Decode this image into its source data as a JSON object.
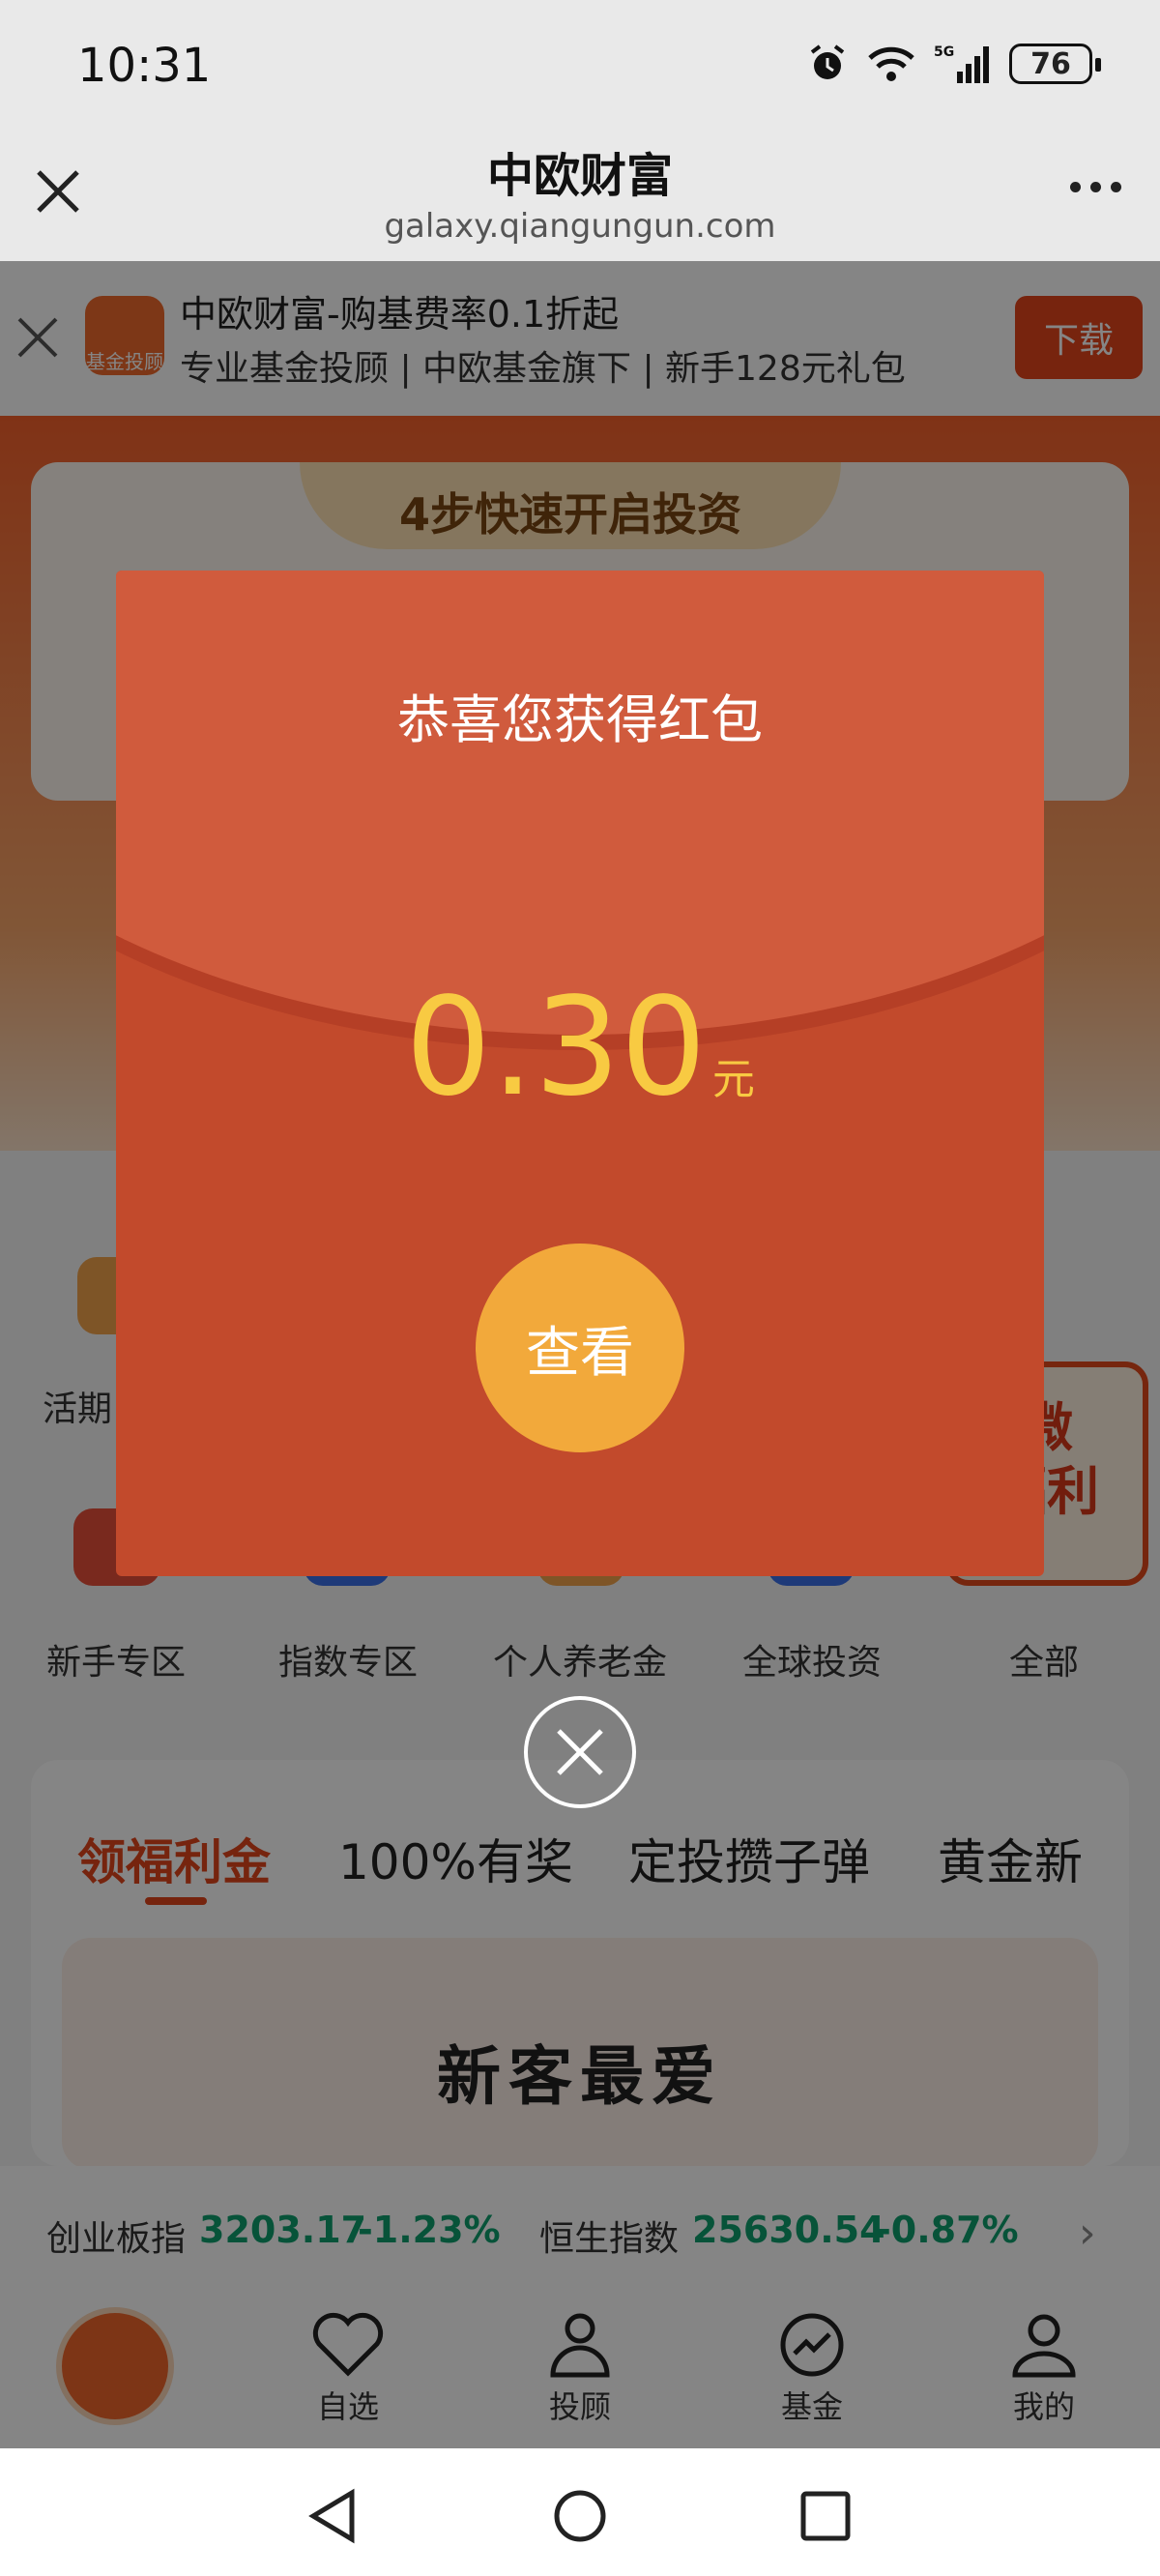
{
  "status_bar": {
    "time": "10:31",
    "battery": "76",
    "network": "5G"
  },
  "browser_nav": {
    "title": "中欧财富",
    "url": "galaxy.qiangungun.com"
  },
  "app_banner": {
    "logo_text": "基金投顾",
    "title": "中欧财富-购基费率0.1折起",
    "subtitle": "专业基金投顾 | 中欧基金旗下 | 新手128元礼包",
    "download_label": "下载"
  },
  "hero": {
    "steps_title": "4步快速开启投资"
  },
  "quick_entries": {
    "partial_label": "活期",
    "items": [
      "新手专区",
      "指数专区",
      "个人养老金",
      "全球投资",
      "全部"
    ],
    "welfare_tag": "微\n福利"
  },
  "tabs": [
    "领福利金",
    "100%有奖",
    "定投攒子弹",
    "黄金新"
  ],
  "featured": {
    "title": "新客最爱"
  },
  "ticker": [
    {
      "name": "创业板指",
      "value": "3203.17",
      "change": "-1.23%"
    },
    {
      "name": "恒生指数",
      "value": "25630.54",
      "change": "-0.87%"
    }
  ],
  "bottom_tabs": [
    "自选",
    "投顾",
    "基金",
    "我的"
  ],
  "red_packet": {
    "title": "恭喜您获得红包",
    "amount": "0.30",
    "unit": "元",
    "view_label": "查看"
  },
  "colors": {
    "brand": "#f0672b",
    "packet": "#c24a2c",
    "amount": "#f8ca42",
    "button": "#f2a93b",
    "up_down_green": "#0e9f6e"
  }
}
